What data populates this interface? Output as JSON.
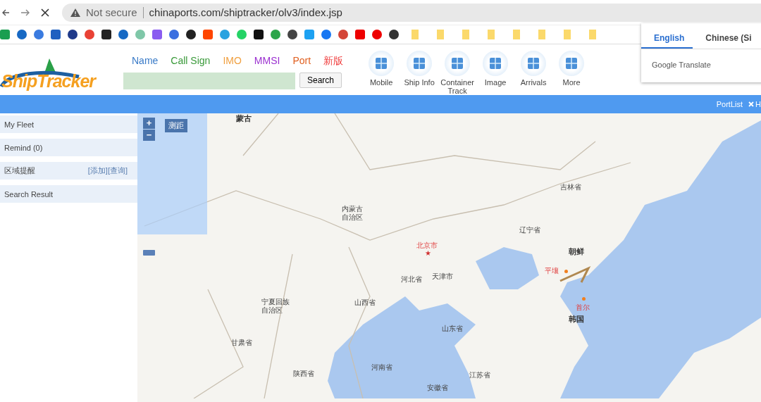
{
  "browser": {
    "security": "Not secure",
    "url": "chinaports.com/shiptracker/olv3/index.jsp"
  },
  "translate_popup": {
    "tabs": [
      {
        "label": "English",
        "selected": true
      },
      {
        "label": "Chinese (Si",
        "selected": false
      }
    ],
    "footer": "Google Translate"
  },
  "header": {
    "logo": "ShipTracker",
    "search_types": [
      {
        "label": "Name",
        "color": "#3a7bc8"
      },
      {
        "label": "Call Sign",
        "color": "#3a9a3a"
      },
      {
        "label": "IMO",
        "color": "#f0a040"
      },
      {
        "label": "MMSI",
        "color": "#9b30d0"
      },
      {
        "label": "Port",
        "color": "#e06020"
      },
      {
        "label": "新版",
        "color": "#f04040"
      }
    ],
    "search_button": "Search",
    "nav": [
      "Mobile",
      "Ship Info",
      "Container Track",
      "Image",
      "Arrivals",
      "More"
    ]
  },
  "toolbar": {
    "port_list": "PortList",
    "close": "H"
  },
  "sidebar": {
    "items": [
      {
        "label": "My Fleet"
      },
      {
        "label": "Remind (0)"
      },
      {
        "label": "区域提醒",
        "links": "[添加][查询]"
      },
      {
        "label": "Search Result"
      }
    ]
  },
  "map": {
    "capital_marker": "★",
    "measure_button": "测距",
    "zoom_in": "+",
    "zoom_out": "−",
    "labels": [
      {
        "text": "蒙古",
        "kind": "country"
      },
      {
        "text": "内蒙古自治区",
        "kind": "region"
      },
      {
        "text": "北京市",
        "kind": "capital"
      },
      {
        "text": "河北省",
        "kind": "region"
      },
      {
        "text": "天津市",
        "kind": "region"
      },
      {
        "text": "辽宁省",
        "kind": "region"
      },
      {
        "text": "吉林省",
        "kind": "region"
      },
      {
        "text": "朝鲜",
        "kind": "country"
      },
      {
        "text": "平壤",
        "kind": "capital"
      },
      {
        "text": "首尔",
        "kind": "capital"
      },
      {
        "text": "韩国",
        "kind": "country"
      },
      {
        "text": "宁夏回族自治区",
        "kind": "region"
      },
      {
        "text": "山西省",
        "kind": "region"
      },
      {
        "text": "山东省",
        "kind": "region"
      },
      {
        "text": "甘肃省",
        "kind": "region"
      },
      {
        "text": "河南省",
        "kind": "region"
      },
      {
        "text": "陕西省",
        "kind": "region"
      },
      {
        "text": "江苏省",
        "kind": "region"
      },
      {
        "text": "安徽省",
        "kind": "region"
      }
    ]
  }
}
